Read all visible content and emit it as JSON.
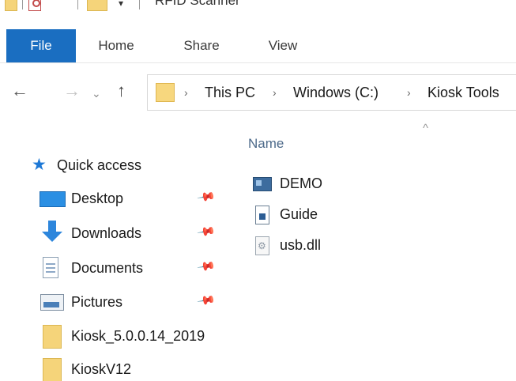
{
  "window": {
    "title": "RFID Scanner"
  },
  "quick_access_toolbar": {
    "dropdown_glyph": "▾",
    "icons": [
      "folder-icon",
      "properties-icon",
      "new-folder-icon"
    ]
  },
  "ribbon": {
    "tabs": [
      {
        "label": "File",
        "active": true
      },
      {
        "label": "Home",
        "active": false
      },
      {
        "label": "Share",
        "active": false
      },
      {
        "label": "View",
        "active": false
      }
    ],
    "accent_color": "#1a6ec1"
  },
  "navigation": {
    "back_glyph": "←",
    "forward_glyph": "→",
    "recent_glyph": "⌄",
    "up_glyph": "↑",
    "breadcrumb_separator": "›",
    "breadcrumb": [
      "This PC",
      "Windows (C:)",
      "Kiosk Tools"
    ]
  },
  "file_list": {
    "column_header": "Name",
    "sort_glyph": "^",
    "items": [
      {
        "name": "DEMO",
        "icon": "application-icon"
      },
      {
        "name": "Guide",
        "icon": "document-icon"
      },
      {
        "name": "usb.dll",
        "icon": "dll-icon"
      }
    ]
  },
  "nav_pane": {
    "quick_access_label": "Quick access",
    "items": [
      {
        "label": "Desktop",
        "icon": "desktop-icon",
        "pinned": true
      },
      {
        "label": "Downloads",
        "icon": "downloads-icon",
        "pinned": true
      },
      {
        "label": "Documents",
        "icon": "documents-icon",
        "pinned": true
      },
      {
        "label": "Pictures",
        "icon": "pictures-icon",
        "pinned": true
      },
      {
        "label": "Kiosk_5.0.0.14_2019",
        "icon": "folder-icon",
        "pinned": false
      },
      {
        "label": "KioskV12",
        "icon": "folder-icon",
        "pinned": false
      }
    ],
    "pin_glyph": "📌"
  }
}
